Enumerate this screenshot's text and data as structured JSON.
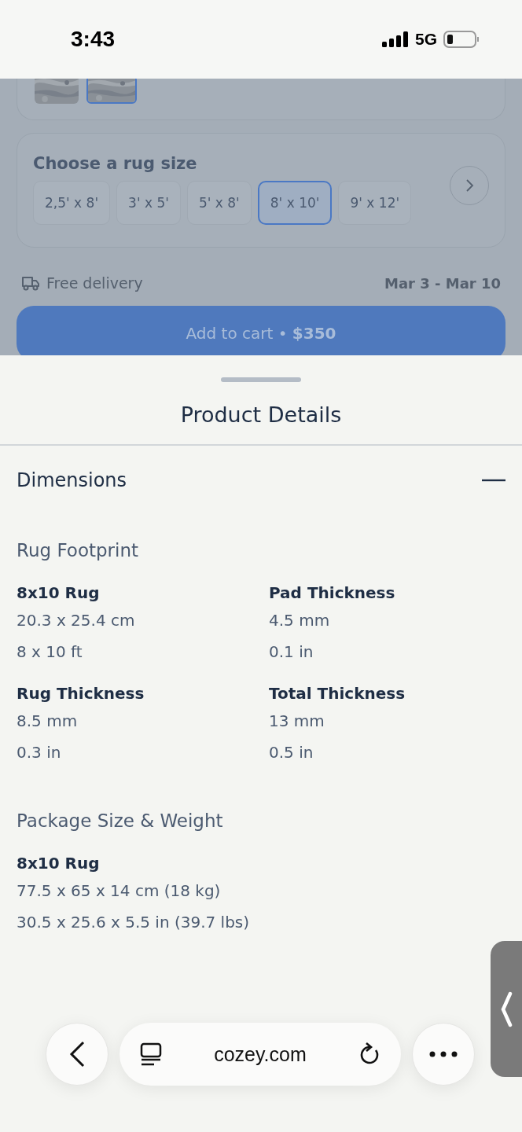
{
  "status_bar": {
    "time": "3:43",
    "network": "5G"
  },
  "swatches": [
    {
      "kind": "picture",
      "selected": false
    },
    {
      "kind": "picture",
      "selected": true
    }
  ],
  "size_picker": {
    "title": "Choose a rug size",
    "sizes": [
      {
        "label": "2,5' x 8'",
        "selected": false
      },
      {
        "label": "3' x 5'",
        "selected": false
      },
      {
        "label": "5' x 8'",
        "selected": false
      },
      {
        "label": "8' x 10'",
        "selected": true
      },
      {
        "label": "9' x 12'",
        "selected": false
      }
    ]
  },
  "delivery": {
    "label": "Free delivery",
    "dates": "Mar 3 - Mar 10"
  },
  "cart_button": {
    "label": "Add to cart • **$350**"
  },
  "sheet": {
    "title": "Product Details",
    "section": {
      "title": "Dimensions",
      "expanded": true,
      "groups": [
        {
          "title": "Rug Footprint",
          "items": [
            {
              "label": "8x10 Rug",
              "values": [
                "20.3 x 25.4 cm",
                "8 x 10 ft"
              ]
            },
            {
              "label": "Pad Thickness",
              "values": [
                "4.5 mm",
                "0.1 in"
              ]
            },
            {
              "label": "Rug Thickness",
              "values": [
                "8.5 mm",
                "0.3 in"
              ]
            },
            {
              "label": "Total Thickness",
              "values": [
                "13 mm",
                "0.5 in"
              ]
            }
          ]
        },
        {
          "title": "Package Size & Weight",
          "items": [
            {
              "label": "8x10 Rug",
              "values": [
                "77.5 x 65 x 14 cm (18 kg)",
                "30.5 x 25.6 x 5.5 in (39.7 lbs)"
              ]
            }
          ]
        }
      ]
    }
  },
  "browser": {
    "url": "cozey.com"
  }
}
